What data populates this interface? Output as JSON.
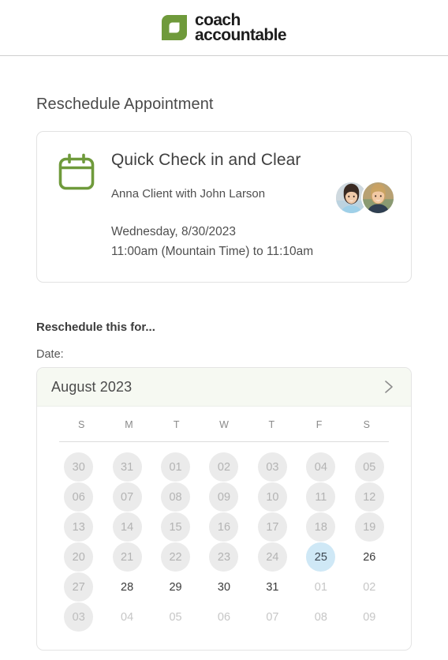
{
  "brand": {
    "name_line1": "coach",
    "name_line2": "accountable",
    "logo_color": "#6f9a3b",
    "logo_icon": "leaf-square-logo"
  },
  "page": {
    "title": "Reschedule Appointment"
  },
  "appointment": {
    "icon": "calendar-icon",
    "icon_color": "#6f9a3b",
    "title": "Quick Check in and Clear",
    "participants": "Anna Client with John Larson",
    "date": "Wednesday, 8/30/2023",
    "time": "11:00am (Mountain Time) to 11:10am",
    "avatars": [
      {
        "name": "anna-client-avatar",
        "alt": "Anna Client"
      },
      {
        "name": "john-larson-avatar",
        "alt": "John Larson"
      }
    ]
  },
  "reschedule": {
    "section_title": "Reschedule this for...",
    "date_label": "Date:"
  },
  "calendar": {
    "month_label": "August 2023",
    "next_month_icon": "chevron-right-icon",
    "selected_color": "#cfe8f6",
    "disabled_color": "#ebebeb",
    "weekday_headers": [
      "S",
      "M",
      "T",
      "W",
      "T",
      "F",
      "S"
    ],
    "weeks": [
      [
        {
          "label": "30",
          "state": "disabled"
        },
        {
          "label": "31",
          "state": "disabled"
        },
        {
          "label": "01",
          "state": "disabled"
        },
        {
          "label": "02",
          "state": "disabled"
        },
        {
          "label": "03",
          "state": "disabled"
        },
        {
          "label": "04",
          "state": "disabled"
        },
        {
          "label": "05",
          "state": "disabled"
        }
      ],
      [
        {
          "label": "06",
          "state": "disabled"
        },
        {
          "label": "07",
          "state": "disabled"
        },
        {
          "label": "08",
          "state": "disabled"
        },
        {
          "label": "09",
          "state": "disabled"
        },
        {
          "label": "10",
          "state": "disabled"
        },
        {
          "label": "11",
          "state": "disabled"
        },
        {
          "label": "12",
          "state": "disabled"
        }
      ],
      [
        {
          "label": "13",
          "state": "disabled"
        },
        {
          "label": "14",
          "state": "disabled"
        },
        {
          "label": "15",
          "state": "disabled"
        },
        {
          "label": "16",
          "state": "disabled"
        },
        {
          "label": "17",
          "state": "disabled"
        },
        {
          "label": "18",
          "state": "disabled"
        },
        {
          "label": "19",
          "state": "disabled"
        }
      ],
      [
        {
          "label": "20",
          "state": "disabled"
        },
        {
          "label": "21",
          "state": "disabled"
        },
        {
          "label": "22",
          "state": "disabled"
        },
        {
          "label": "23",
          "state": "disabled"
        },
        {
          "label": "24",
          "state": "disabled"
        },
        {
          "label": "25",
          "state": "selected"
        },
        {
          "label": "26",
          "state": "available"
        }
      ],
      [
        {
          "label": "27",
          "state": "disabled"
        },
        {
          "label": "28",
          "state": "available"
        },
        {
          "label": "29",
          "state": "available"
        },
        {
          "label": "30",
          "state": "available"
        },
        {
          "label": "31",
          "state": "available"
        },
        {
          "label": "01",
          "state": "outside"
        },
        {
          "label": "02",
          "state": "outside"
        }
      ],
      [
        {
          "label": "03",
          "state": "outside-disabled"
        },
        {
          "label": "04",
          "state": "outside"
        },
        {
          "label": "05",
          "state": "outside"
        },
        {
          "label": "06",
          "state": "outside"
        },
        {
          "label": "07",
          "state": "outside"
        },
        {
          "label": "08",
          "state": "outside"
        },
        {
          "label": "09",
          "state": "outside"
        }
      ]
    ]
  }
}
